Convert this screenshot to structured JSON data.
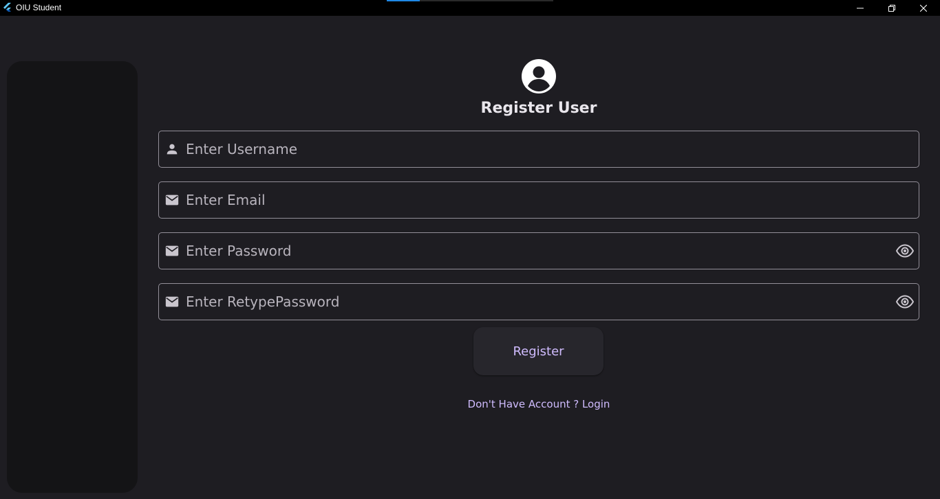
{
  "window": {
    "title": "OIU Student",
    "loading_progress": 0.2,
    "accent_color": "#1e88e5"
  },
  "form": {
    "avatar_icon": "account-circle-icon",
    "title": "Register User",
    "username": {
      "placeholder": "Enter Username",
      "value": "",
      "icon": "person-icon"
    },
    "email": {
      "placeholder": "Enter Email",
      "value": "",
      "icon": "mail-icon"
    },
    "password": {
      "placeholder": "Enter Password",
      "value": "",
      "icon": "mail-icon",
      "toggle_icon": "eye-icon"
    },
    "retype_password": {
      "placeholder": "Enter RetypePassword",
      "value": "",
      "icon": "mail-icon",
      "toggle_icon": "eye-icon"
    },
    "submit_label": "Register",
    "login_link": "Don't Have Account ? Login"
  },
  "colors": {
    "background": "#1e1d22",
    "sidebar": "#141416",
    "primary": "#d0bcff",
    "outline": "#938f99"
  }
}
